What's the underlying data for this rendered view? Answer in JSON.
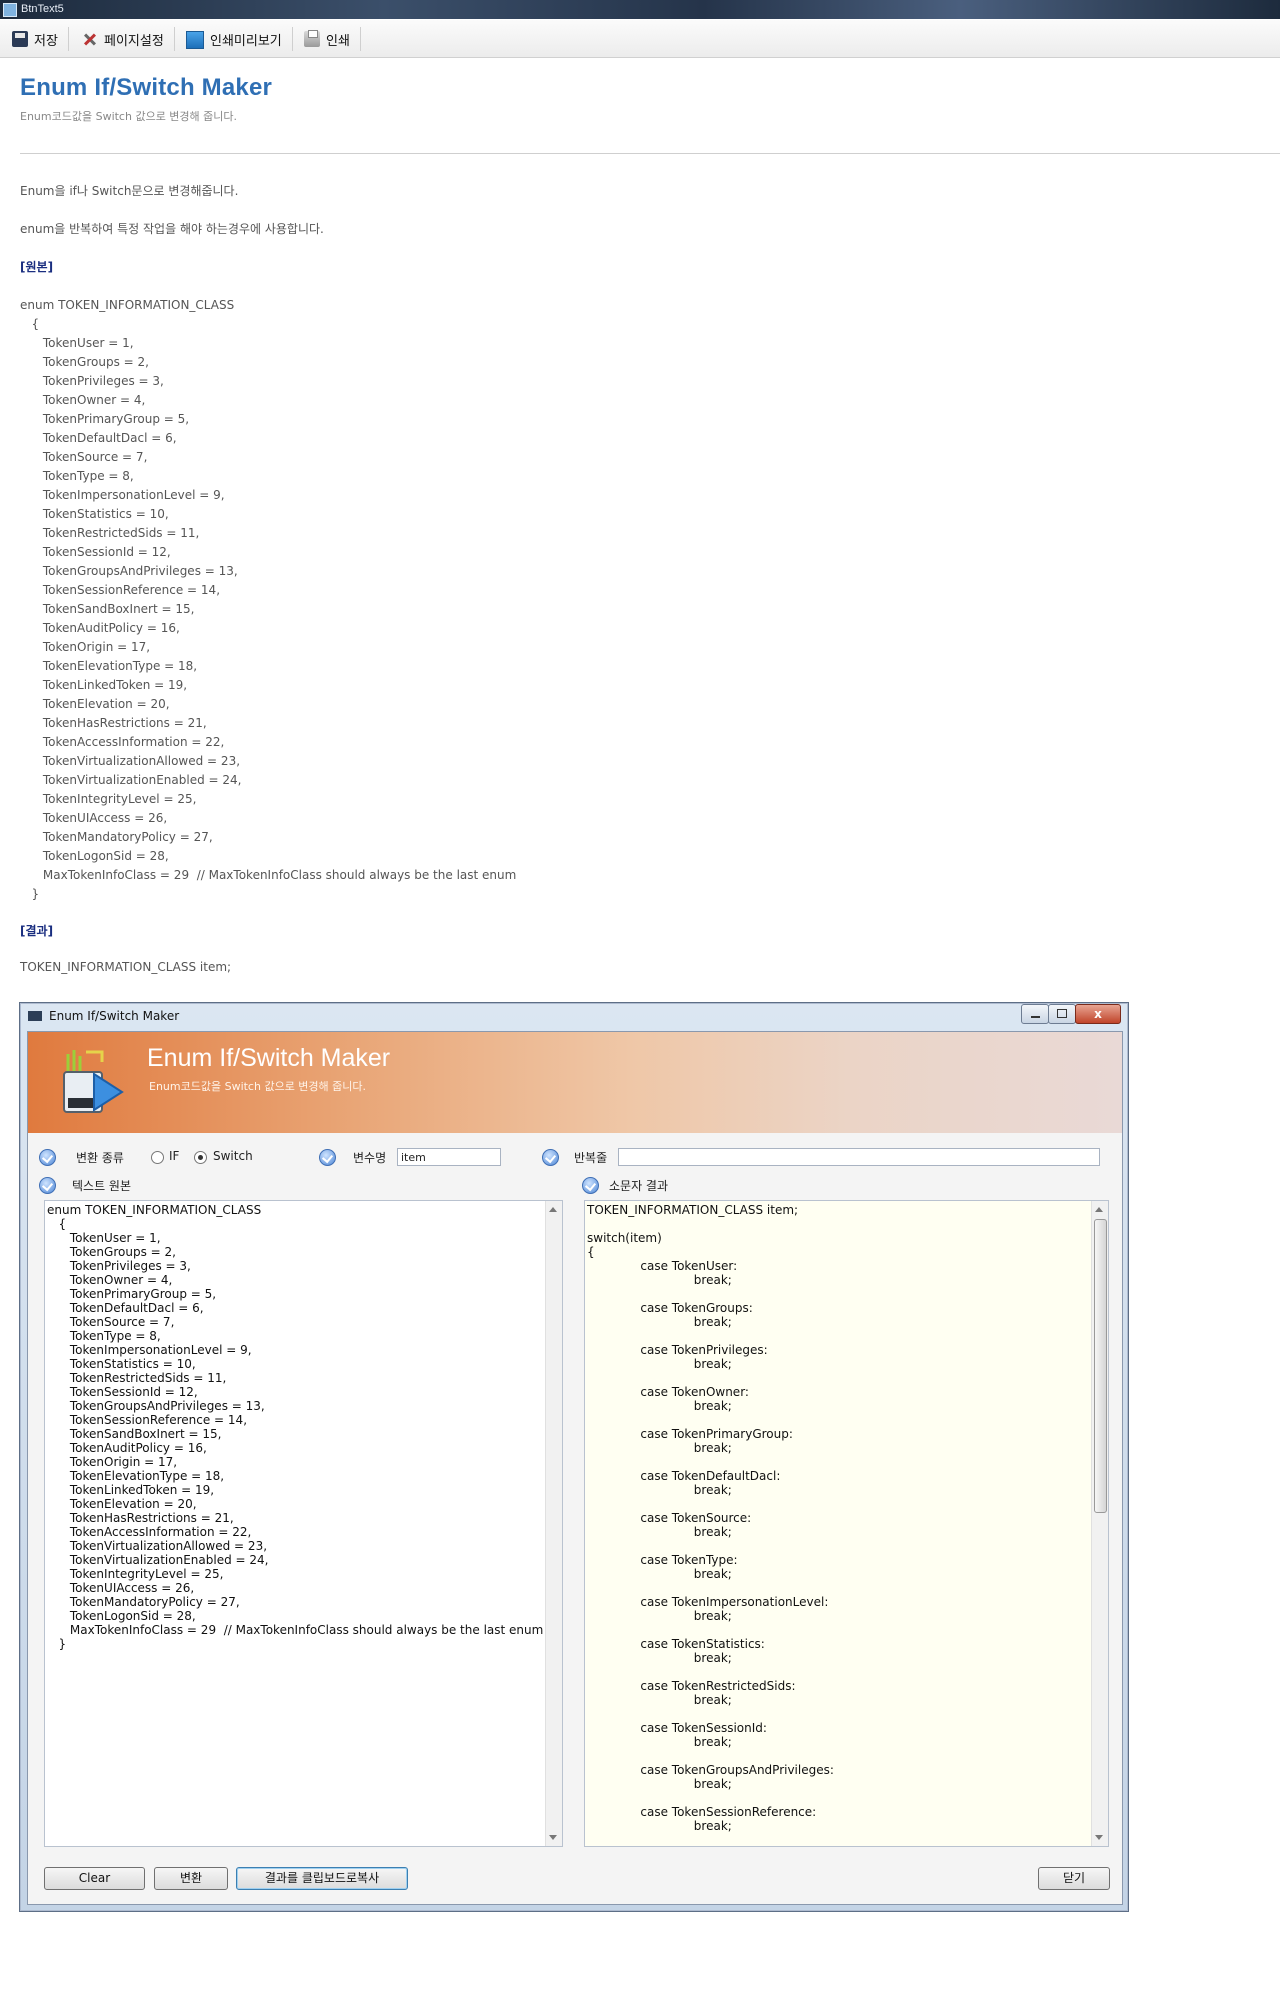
{
  "window": {
    "title": "BtnText5"
  },
  "toolbar": {
    "items": [
      {
        "label": "저장",
        "icon": "save-icon"
      },
      {
        "label": "페이지설정",
        "icon": "tools-icon"
      },
      {
        "label": "인쇄미리보기",
        "icon": "print-preview-icon"
      },
      {
        "label": "인쇄",
        "icon": "printer-icon"
      }
    ]
  },
  "page": {
    "title": "Enum If/Switch Maker",
    "subtitle": "Enum코드값을 Switch 값으로 변경해 줍니다.",
    "intro1": "Enum을 if나 Switch문으로 변경해줍니다.",
    "intro2": "enum을 반복하여 특정 작업을 해야 하는경우에 사용합니다.",
    "section_original": "[원본]",
    "section_result": "[결과]",
    "result_first_line": "TOKEN_INFORMATION_CLASS item;"
  },
  "original_code": [
    "enum TOKEN_INFORMATION_CLASS",
    "   {",
    "      TokenUser = 1,",
    "      TokenGroups = 2,",
    "      TokenPrivileges = 3,",
    "      TokenOwner = 4,",
    "      TokenPrimaryGroup = 5,",
    "      TokenDefaultDacl = 6,",
    "      TokenSource = 7,",
    "      TokenType = 8,",
    "      TokenImpersonationLevel = 9,",
    "      TokenStatistics = 10,",
    "      TokenRestrictedSids = 11,",
    "      TokenSessionId = 12,",
    "      TokenGroupsAndPrivileges = 13,",
    "      TokenSessionReference = 14,",
    "      TokenSandBoxInert = 15,",
    "      TokenAuditPolicy = 16,",
    "      TokenOrigin = 17,",
    "      TokenElevationType = 18,",
    "      TokenLinkedToken = 19,",
    "      TokenElevation = 20,",
    "      TokenHasRestrictions = 21,",
    "      TokenAccessInformation = 22,",
    "      TokenVirtualizationAllowed = 23,",
    "      TokenVirtualizationEnabled = 24,",
    "      TokenIntegrityLevel = 25,",
    "      TokenUIAccess = 26,",
    "      TokenMandatoryPolicy = 27,",
    "      TokenLogonSid = 28,",
    "      MaxTokenInfoClass = 29  // MaxTokenInfoClass should always be the last enum",
    "   }"
  ],
  "app": {
    "window_title": "Enum If/Switch Maker",
    "close_glyph": "x",
    "banner_title": "Enum If/Switch Maker",
    "banner_subtitle": "Enum코드값을 Switch 값으로 변경해 줍니다.",
    "convert_type_label": "변환 종류",
    "radio_if": "IF",
    "radio_switch": "Switch",
    "selected": "Switch",
    "var_name_label": "변수명",
    "var_name_value": "item",
    "repeat_label": "반복줄",
    "repeat_value": "",
    "source_label": "텍스트 원본",
    "result_label": "소문자 결과",
    "buttons": {
      "clear": "Clear",
      "convert": "변환",
      "copy": "결과를 클립보드로복사",
      "close": "닫기"
    }
  },
  "result_code": [
    "TOKEN_INFORMATION_CLASS item;",
    "",
    "switch(item)",
    "{",
    "              case TokenUser:",
    "                            break;",
    "",
    "              case TokenGroups:",
    "                            break;",
    "",
    "              case TokenPrivileges:",
    "                            break;",
    "",
    "              case TokenOwner:",
    "                            break;",
    "",
    "              case TokenPrimaryGroup:",
    "                            break;",
    "",
    "              case TokenDefaultDacl:",
    "                            break;",
    "",
    "              case TokenSource:",
    "                            break;",
    "",
    "              case TokenType:",
    "                            break;",
    "",
    "              case TokenImpersonationLevel:",
    "                            break;",
    "",
    "              case TokenStatistics:",
    "                            break;",
    "",
    "              case TokenRestrictedSids:",
    "                            break;",
    "",
    "              case TokenSessionId:",
    "                            break;",
    "",
    "              case TokenGroupsAndPrivileges:",
    "                            break;",
    "",
    "              case TokenSessionReference:",
    "                            break;"
  ],
  "colors": {
    "title_blue": "#2f6fb4",
    "section_navy": "#1a2e80",
    "banner_orange": "#e07a3e",
    "result_bg": "#fffff2"
  }
}
